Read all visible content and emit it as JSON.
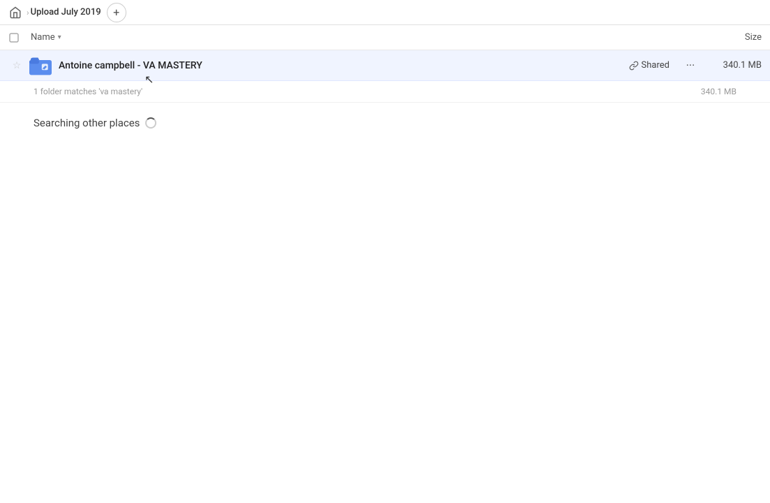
{
  "topbar": {
    "home_label": "Home",
    "breadcrumb_title": "Upload July 2019",
    "add_button_label": "+"
  },
  "columns": {
    "name_label": "Name",
    "size_label": "Size"
  },
  "file_row": {
    "name": "Antoine campbell - VA MASTERY",
    "shared_label": "Shared",
    "size": "340.1 MB",
    "more_label": "···"
  },
  "search_info": {
    "matches_text": "1 folder matches 'va mastery'",
    "size": "340.1 MB"
  },
  "searching": {
    "label": "Searching other places"
  },
  "icons": {
    "home": "🏠",
    "star": "☆",
    "link": "🔗",
    "more": "···",
    "chevron_right": "›",
    "chevron_down": "▾"
  }
}
